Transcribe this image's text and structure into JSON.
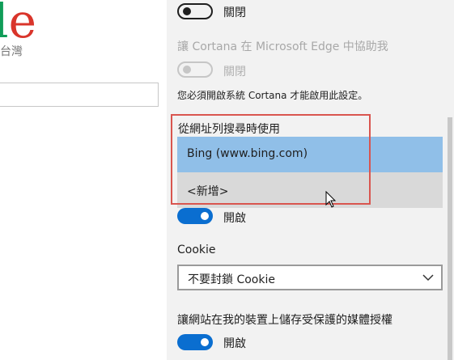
{
  "page": {
    "logo_fragment_left": "l",
    "logo_fragment_right": "e",
    "region": "台灣",
    "search_value": ""
  },
  "settings": {
    "toggle1": {
      "label": "關閉",
      "state": "off"
    },
    "cortana": {
      "label": "讓 Cortana 在 Microsoft Edge 中協助我",
      "toggle_label": "關閉",
      "note": "您必須開啟系統 Cortana 才能啟用此設定。"
    },
    "search_engine": {
      "label": "從網址列搜尋時使用",
      "options": [
        "Bing (www.bing.com)",
        "<新增>"
      ],
      "selected": "Bing (www.bing.com)"
    },
    "toggle_after_search": {
      "label": "開啟",
      "state": "on"
    },
    "cookie": {
      "label": "Cookie",
      "value": "不要封鎖 Cookie"
    },
    "media_license": {
      "label": "讓網站在我的裝置上儲存受保護的媒體授權",
      "toggle_label": "開啟",
      "state": "on"
    }
  },
  "colors": {
    "accent": "#0a6ed0",
    "highlight": "#d9554f",
    "selected_option": "#90bfe8"
  }
}
